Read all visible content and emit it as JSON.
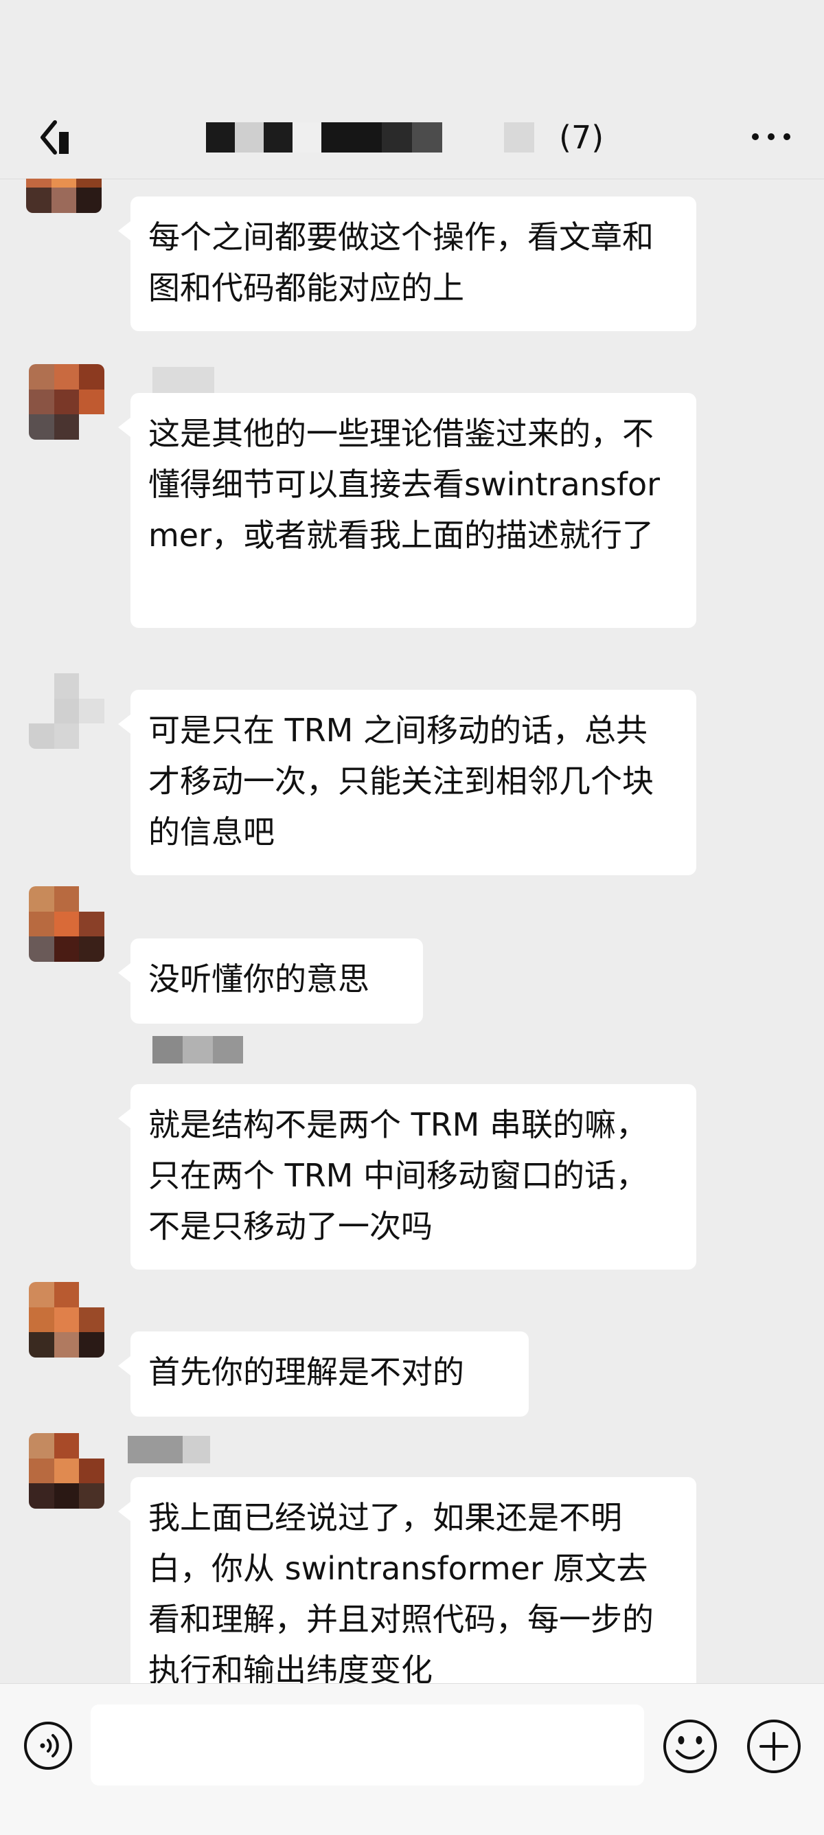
{
  "header": {
    "member_count": "(7)",
    "icons": {
      "back": "chevron-left-icon",
      "more": "more-horizontal-icon"
    }
  },
  "messages": [
    {
      "id": 1,
      "text": "每个之间都要做这个操作，看文章和图和代码都能对应的上"
    },
    {
      "id": 2,
      "text": "这是其他的一些理论借鉴过来的，不懂得细节可以直接去看swintransformer，或者就看我上面的描述就行了"
    },
    {
      "id": 3,
      "text": "可是只在 TRM 之间移动的话，总共才移动一次，只能关注到相邻几个块的信息吧"
    },
    {
      "id": 4,
      "text": "没听懂你的意思"
    },
    {
      "id": 5,
      "text": "就是结构不是两个 TRM 串联的嘛，只在两个 TRM 中间移动窗口的话，不是只移动了一次吗"
    },
    {
      "id": 6,
      "text": "首先你的理解是不对的"
    },
    {
      "id": 7,
      "text": "我上面已经说过了，如果还是不明白，你从 swintransformer 原文去看和理解，并且对照代码，每一步的执行和输出纬度变化"
    }
  ],
  "input_bar": {
    "message_value": "",
    "icons": {
      "voice": "voice-icon",
      "emoji": "emoji-icon",
      "plus": "plus-icon"
    }
  },
  "colors": {
    "background": "#ededed",
    "bubble": "#ffffff",
    "text": "#111111",
    "input_bar": "#f7f7f7"
  }
}
